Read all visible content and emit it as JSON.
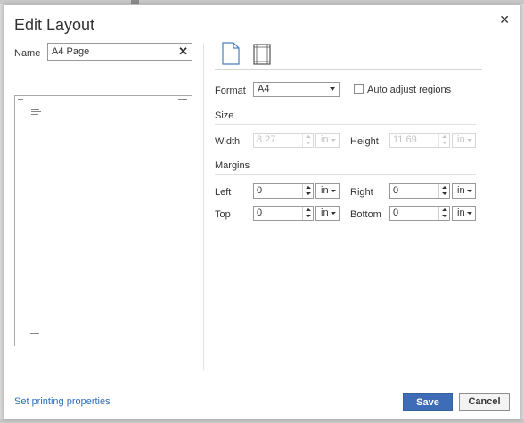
{
  "dialog": {
    "title": "Edit Layout",
    "close_icon": "close-icon"
  },
  "name": {
    "label": "Name",
    "value": "A4 Page",
    "clear_icon": "clear-icon"
  },
  "tabs": [
    {
      "icon": "page-icon",
      "active": true
    },
    {
      "icon": "margins-icon",
      "active": false
    }
  ],
  "format": {
    "label": "Format",
    "value": "A4",
    "auto_adjust_label": "Auto adjust regions",
    "auto_adjust_checked": false
  },
  "size": {
    "heading": "Size",
    "width_label": "Width",
    "width_value": "8.27",
    "width_unit": "in",
    "height_label": "Height",
    "height_value": "11.69",
    "height_unit": "in"
  },
  "margins": {
    "heading": "Margins",
    "left_label": "Left",
    "left_value": "0",
    "left_unit": "in",
    "right_label": "Right",
    "right_value": "0",
    "right_unit": "in",
    "top_label": "Top",
    "top_value": "0",
    "top_unit": "in",
    "bottom_label": "Bottom",
    "bottom_value": "0",
    "bottom_unit": "in"
  },
  "footer": {
    "link": "Set printing properties",
    "save": "Save",
    "cancel": "Cancel"
  },
  "colors": {
    "primary_button": "#3f6cb6",
    "link": "#2a6ebb"
  }
}
